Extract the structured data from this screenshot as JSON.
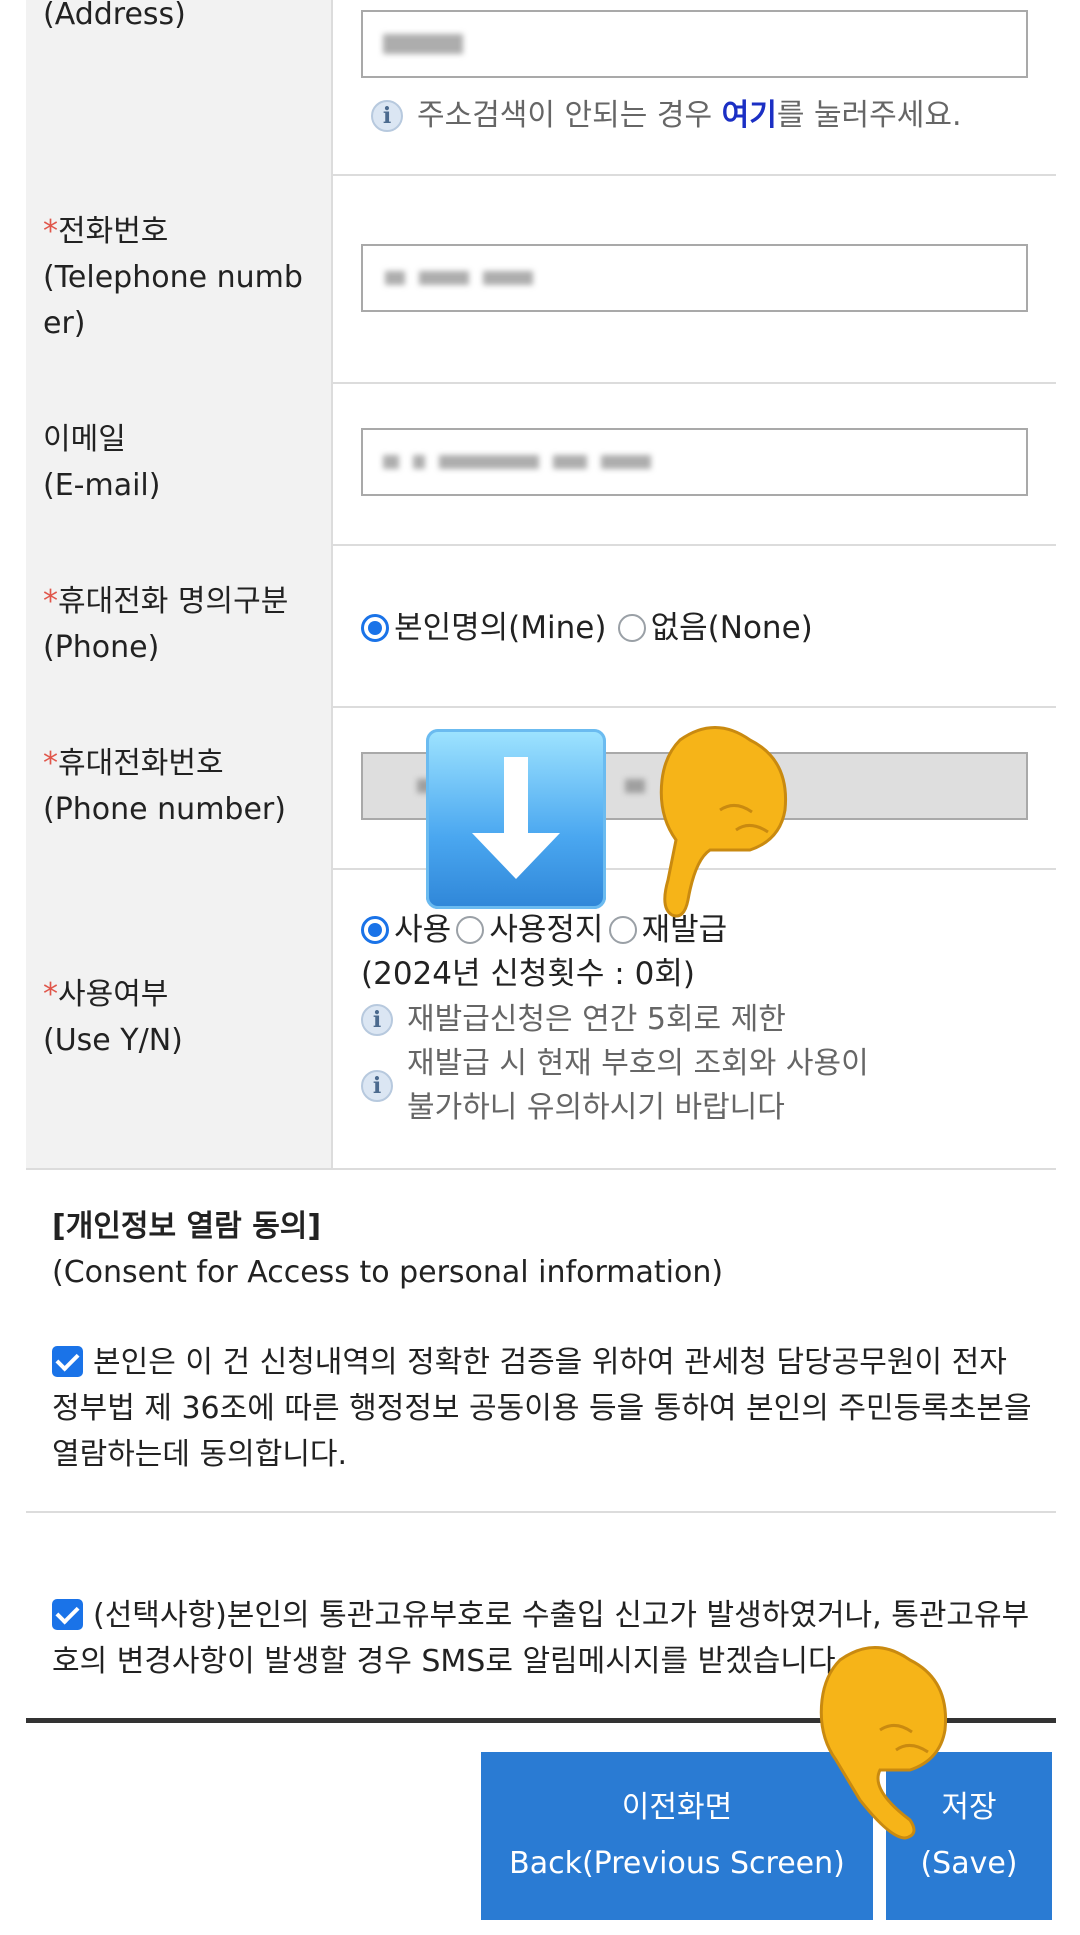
{
  "address_row": {
    "label_ko": "",
    "label_en": "(Address)",
    "info_prefix": "주소검색이 안되는 경우 ",
    "info_link": "여기",
    "info_suffix": "를 눌러주세요."
  },
  "telephone_row": {
    "required_mark": "*",
    "label_ko": "전화번호",
    "label_en_1": "(Telephone numb",
    "label_en_2": "er)"
  },
  "email_row": {
    "label_ko": "이메일",
    "label_en": "(E-mail)"
  },
  "phone_owner_row": {
    "required_mark": "*",
    "label_ko": "휴대전화 명의구분",
    "label_en": "(Phone)",
    "options": [
      {
        "label": "본인명의(Mine)",
        "checked": true
      },
      {
        "label": "없음(None)",
        "checked": false
      }
    ]
  },
  "phone_number_row": {
    "required_mark": "*",
    "label_ko": "휴대전화번호",
    "label_en": "(Phone number)"
  },
  "use_row": {
    "required_mark": "*",
    "label_ko": "사용여부",
    "label_en": "(Use Y/N)",
    "options": [
      {
        "label": "사용",
        "checked": true
      },
      {
        "label": "사용정지",
        "checked": false
      },
      {
        "label": "재발급",
        "checked": false
      }
    ],
    "count_text": "(2024년 신청횟수 : 0회)",
    "info_1": "재발급신청은 연간 5회로 제한",
    "info_2_line1": "재발급 시 현재 부호의 조회와 사용이",
    "info_2_line2": "불가하니 유의하시기 바랍니다"
  },
  "consent": {
    "title": "[개인정보 열람 동의]",
    "subtitle": "(Consent for Access to personal information)",
    "item_1": "본인은 이 건 신청내역의 정확한 검증을 위하여 관세청 담당공무원이 전자정부법 제 36조에 따른 행정정보 공동이용 등을 통하여 본인의 주민등록초본을 열람하는데 동의합니다.",
    "item_1_checked": true,
    "item_2": "(선택사항)본인의 통관고유부호로 수출입 신고가 발생하였거나, 통관고유부호의 변경사항이 발생할 경우 SMS로 알림메시지를 받겠습니다",
    "item_2_checked": true
  },
  "buttons": {
    "back_ko": "이전화면",
    "back_en": "Back(Previous Screen)",
    "save_ko": "저장",
    "save_en": "(Save)"
  },
  "colors": {
    "accent": "#1a73e8",
    "button": "#2a7bd3",
    "required": "#e0564a",
    "link": "#1b2fc4"
  },
  "overlays": {
    "arrow": "down-arrow-emoji",
    "hand": "pointing-down-hand-emoji"
  }
}
